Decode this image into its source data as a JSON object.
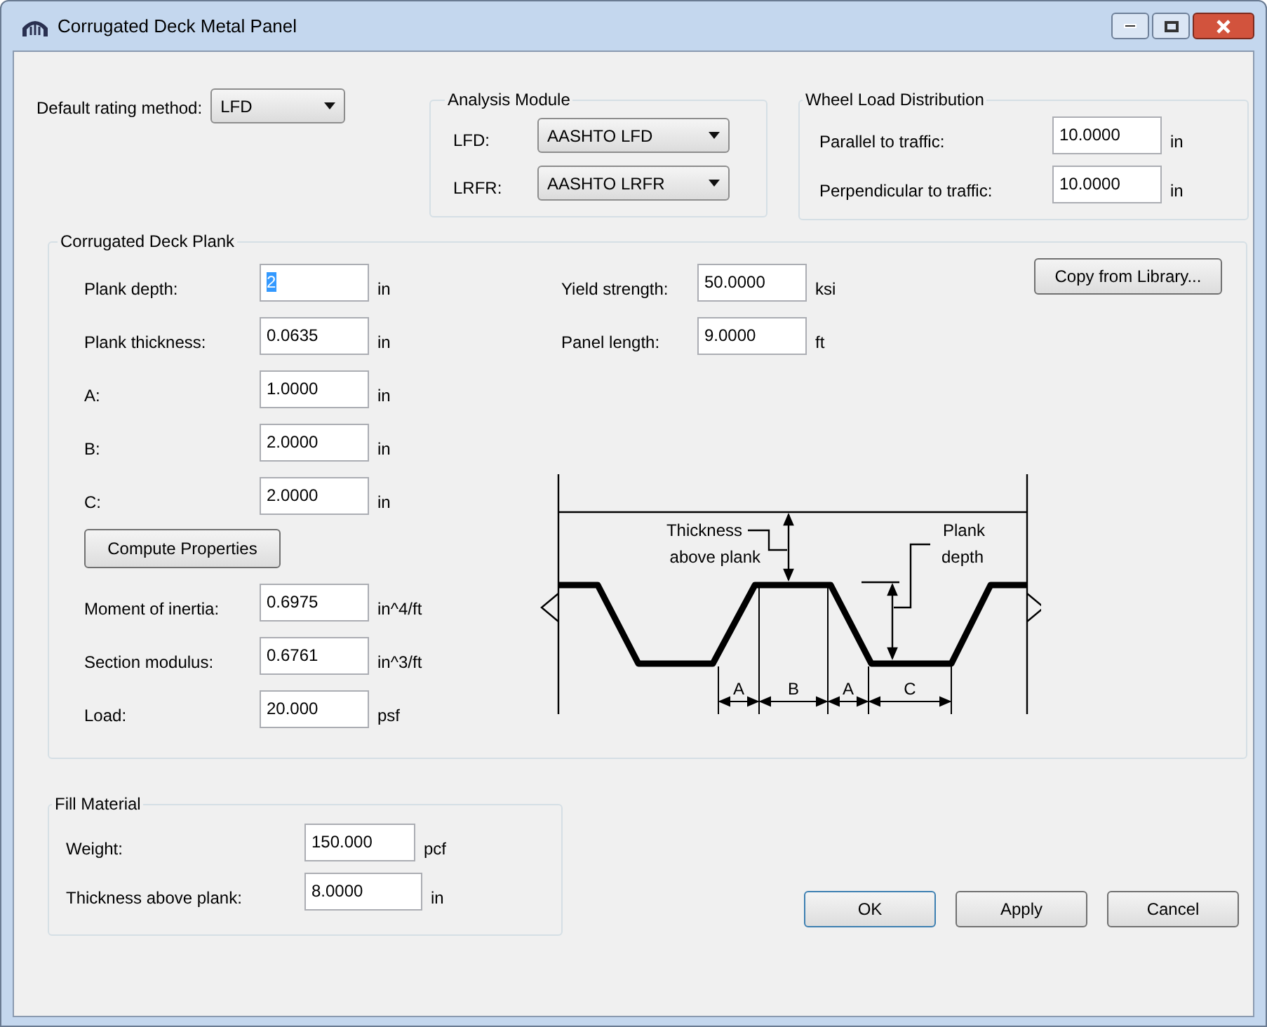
{
  "window": {
    "title": "Corrugated Deck Metal Panel"
  },
  "rating_method": {
    "label": "Default rating method:",
    "value": "LFD"
  },
  "analysis_module": {
    "title": "Analysis Module",
    "rows": [
      {
        "label": "LFD:",
        "value": "AASHTO LFD"
      },
      {
        "label": "LRFR:",
        "value": "AASHTO LRFR"
      }
    ]
  },
  "wheel_load": {
    "title": "Wheel Load Distribution",
    "rows": [
      {
        "label": "Parallel to traffic:",
        "value": "10.0000",
        "unit": "in"
      },
      {
        "label": "Perpendicular to traffic:",
        "value": "10.0000",
        "unit": "in"
      }
    ]
  },
  "plank": {
    "title": "Corrugated Deck Plank",
    "fields": [
      {
        "label": "Plank depth:",
        "value": "2",
        "unit": "in",
        "focused": true
      },
      {
        "label": "Plank thickness:",
        "value": "0.0635",
        "unit": "in",
        "focused": false
      },
      {
        "label": "A:",
        "value": "1.0000",
        "unit": "in",
        "focused": false
      },
      {
        "label": "B:",
        "value": "2.0000",
        "unit": "in",
        "focused": false
      },
      {
        "label": "C:",
        "value": "2.0000",
        "unit": "in",
        "focused": false
      }
    ],
    "compute_button": "Compute Properties",
    "properties": [
      {
        "label": "Moment of inertia:",
        "value": "0.6975",
        "unit": "in^4/ft"
      },
      {
        "label": "Section modulus:",
        "value": "0.6761",
        "unit": "in^3/ft"
      },
      {
        "label": "Load:",
        "value": "20.000",
        "unit": "psf"
      }
    ],
    "material": [
      {
        "label": "Yield strength:",
        "value": "50.0000",
        "unit": "ksi"
      },
      {
        "label": "Panel length:",
        "value": "9.0000",
        "unit": "ft"
      }
    ],
    "copy_button": "Copy from Library...",
    "diagram": {
      "thickness_label": [
        "Thickness",
        "above plank"
      ],
      "depth_label": [
        "Plank",
        "depth"
      ],
      "dims": [
        "A",
        "B",
        "A",
        "C"
      ]
    }
  },
  "fill_material": {
    "title": "Fill Material",
    "rows": [
      {
        "label": "Weight:",
        "value": "150.000",
        "unit": "pcf"
      },
      {
        "label": "Thickness above plank:",
        "value": "8.0000",
        "unit": "in"
      }
    ]
  },
  "buttons": [
    "OK",
    "Apply",
    "Cancel"
  ]
}
